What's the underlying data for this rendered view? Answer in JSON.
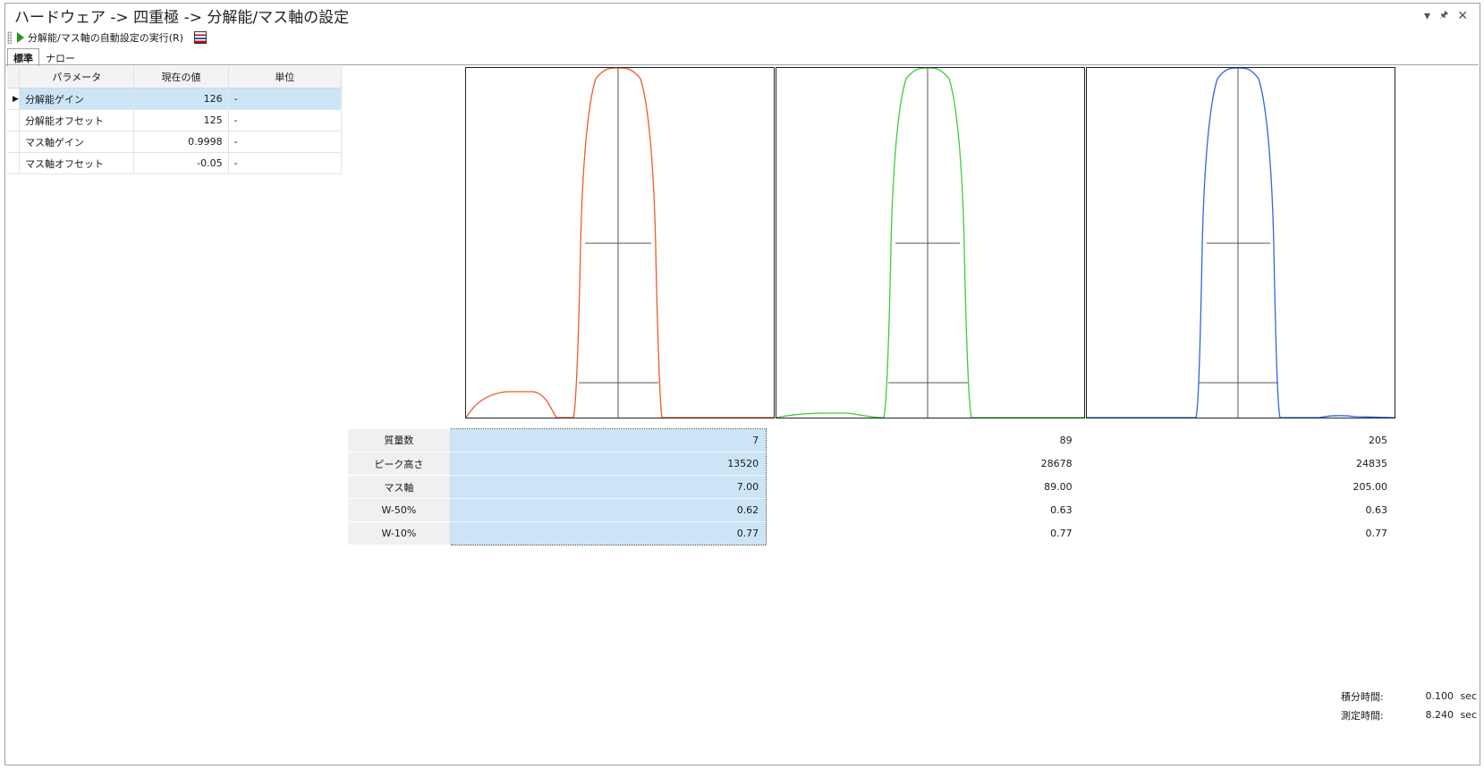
{
  "window": {
    "title": "ハードウェア -> 四重極 -> 分解能/マス軸の設定",
    "controls": {
      "menu": "▾",
      "pin": "📌",
      "close": "✕"
    }
  },
  "toolbar": {
    "run_label": "分解能/マス軸の自動設定の実行(R)"
  },
  "tabs": [
    "標準",
    "ナロー"
  ],
  "param_table": {
    "headers": [
      "パラメータ",
      "現在の値",
      "単位"
    ],
    "rows": [
      {
        "name": "分解能ゲイン",
        "value": "126",
        "unit": "-",
        "selected": true
      },
      {
        "name": "分解能オフセット",
        "value": "125",
        "unit": "-"
      },
      {
        "name": "マス軸ゲイン",
        "value": "0.9998",
        "unit": "-"
      },
      {
        "name": "マス軸オフセット",
        "value": "-0.05",
        "unit": "-"
      }
    ]
  },
  "plots": [
    {
      "color": "#f05a28"
    },
    {
      "color": "#3ccc3c"
    },
    {
      "color": "#2f66e0"
    }
  ],
  "results": {
    "rows": [
      {
        "label": "質量数",
        "values": [
          "7",
          "89",
          "205"
        ]
      },
      {
        "label": "ピーク高さ",
        "values": [
          "13520",
          "28678",
          "24835"
        ]
      },
      {
        "label": "マス軸",
        "values": [
          "7.00",
          "89.00",
          "205.00"
        ]
      },
      {
        "label": "W-50%",
        "values": [
          "0.62",
          "0.63",
          "0.63"
        ]
      },
      {
        "label": "W-10%",
        "values": [
          "0.77",
          "0.77",
          "0.77"
        ]
      }
    ]
  },
  "footer": {
    "integration_label": "積分時間:",
    "integration_value": "0.100",
    "integration_unit": "sec",
    "measure_label": "測定時間:",
    "measure_value": "8.240",
    "measure_unit": "sec"
  }
}
